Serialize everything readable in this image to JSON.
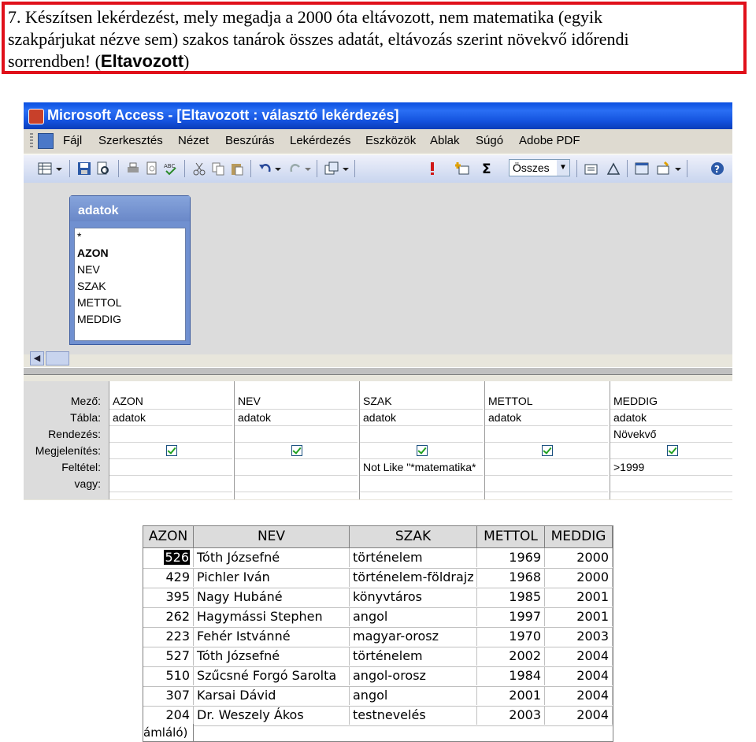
{
  "task": {
    "line1": "7. Készítsen lekérdezést, mely megadja a 2000 óta eltávozott, nem matematika (egyik",
    "line2": "szakpárjukat nézve sem) szakos tanárok összes adatát, eltávozás szerint növekvő időrendi",
    "line3_prefix": "sorrendben! (",
    "line3_bold": "Eltavozott",
    "line3_suffix": ")"
  },
  "window": {
    "title": "Microsoft Access - [Eltavozott : választó lekérdezés]"
  },
  "menu": [
    "Fájl",
    "Szerkesztés",
    "Nézet",
    "Beszúrás",
    "Lekérdezés",
    "Eszközök",
    "Ablak",
    "Súgó",
    "Adobe PDF"
  ],
  "toolbar": {
    "totals_combo": "Összes",
    "icons": [
      "view-icon",
      "save-icon",
      "print-preview-icon",
      "print-icon",
      "spelling-icon",
      "cut-icon",
      "copy-icon",
      "paste-icon",
      "undo-icon",
      "redo-icon",
      "query-type-icon",
      "run-icon",
      "show-table-icon",
      "totals-icon",
      "properties-icon",
      "build-icon",
      "database-window-icon",
      "new-object-icon",
      "help-icon"
    ]
  },
  "fieldlist": {
    "table": "adatok",
    "fields": [
      "*",
      "AZON",
      "NEV",
      "SZAK",
      "METTOL",
      "MEDDIG"
    ]
  },
  "design_grid": {
    "row_labels": [
      "Mező:",
      "Tábla:",
      "Rendezés:",
      "Megjelenítés:",
      "Feltétel:",
      "vagy:"
    ],
    "columns": [
      {
        "field": "AZON",
        "table": "adatok",
        "sort": "",
        "show": true,
        "criteria": ""
      },
      {
        "field": "NEV",
        "table": "adatok",
        "sort": "",
        "show": true,
        "criteria": ""
      },
      {
        "field": "SZAK",
        "table": "adatok",
        "sort": "",
        "show": true,
        "criteria": "Not Like \"*matematika*"
      },
      {
        "field": "METTOL",
        "table": "adatok",
        "sort": "",
        "show": true,
        "criteria": ""
      },
      {
        "field": "MEDDIG",
        "table": "adatok",
        "sort": "Növekvő",
        "show": true,
        "criteria": ">1999"
      }
    ]
  },
  "result": {
    "headers": [
      "AZON",
      "NEV",
      "SZAK",
      "METTOL",
      "MEDDIG"
    ],
    "rows": [
      [
        "526",
        "Tóth Józsefné",
        "történelem",
        "1969",
        "2000"
      ],
      [
        "429",
        "Pichler Iván",
        "történelem-földrajz",
        "1968",
        "2000"
      ],
      [
        "395",
        "Nagy Hubáné",
        "könyvtáros",
        "1985",
        "2001"
      ],
      [
        "262",
        "Hagymássi Stephen",
        "angol",
        "1997",
        "2001"
      ],
      [
        "223",
        "Fehér Istvánné",
        "magyar-orosz",
        "1970",
        "2003"
      ],
      [
        "527",
        "Tóth Józsefné",
        "történelem",
        "2002",
        "2004"
      ],
      [
        "510",
        "Szűcsné Forgó Sarolta",
        "angol-orosz",
        "1984",
        "2004"
      ],
      [
        "307",
        "Karsai Dávid",
        "angol",
        "2001",
        "2004"
      ],
      [
        "204",
        "Dr. Weszely Ákos",
        "testnevelés",
        "2003",
        "2004"
      ]
    ],
    "footer": "ámláló)"
  }
}
